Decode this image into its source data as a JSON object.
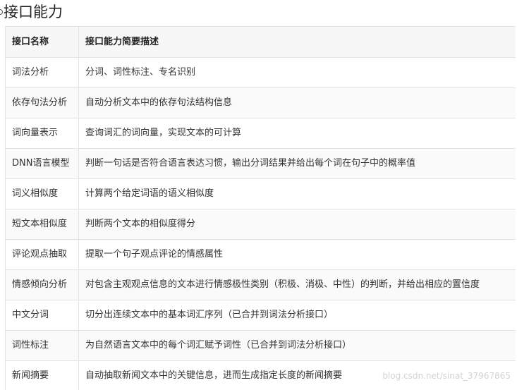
{
  "section": {
    "title": "接口能力"
  },
  "table": {
    "headers": [
      "接口名称",
      "接口能力简要描述"
    ],
    "rows": [
      [
        "词法分析",
        "分词、词性标注、专名识别"
      ],
      [
        "依存句法分析",
        "自动分析文本中的依存句法结构信息"
      ],
      [
        "词向量表示",
        "查询词汇的词向量，实现文本的可计算"
      ],
      [
        "DNN语言模型",
        "判断一句话是否符合语言表达习惯，输出分词结果并给出每个词在句子中的概率值"
      ],
      [
        "词义相似度",
        "计算两个给定词语的语义相似度"
      ],
      [
        "短文本相似度",
        "判断两个文本的相似度得分"
      ],
      [
        "评论观点抽取",
        "提取一个句子观点评论的情感属性"
      ],
      [
        "情感倾向分析",
        "对包含主观观点信息的文本进行情感极性类别（积极、消极、中性）的判断，并给出相应的置信度"
      ],
      [
        "中文分词",
        "切分出连续文本中的基本词汇序列（已合并到词法分析接口）"
      ],
      [
        "词性标注",
        "为自然语言文本中的每个词汇赋予词性（已合并到词法分析接口）"
      ],
      [
        "新闻摘要",
        "自动抽取新闻文本中的关键信息，进而生成指定长度的新闻摘要"
      ]
    ]
  },
  "watermark": {
    "text": "blog.csdn.net/sinat_37967865"
  }
}
